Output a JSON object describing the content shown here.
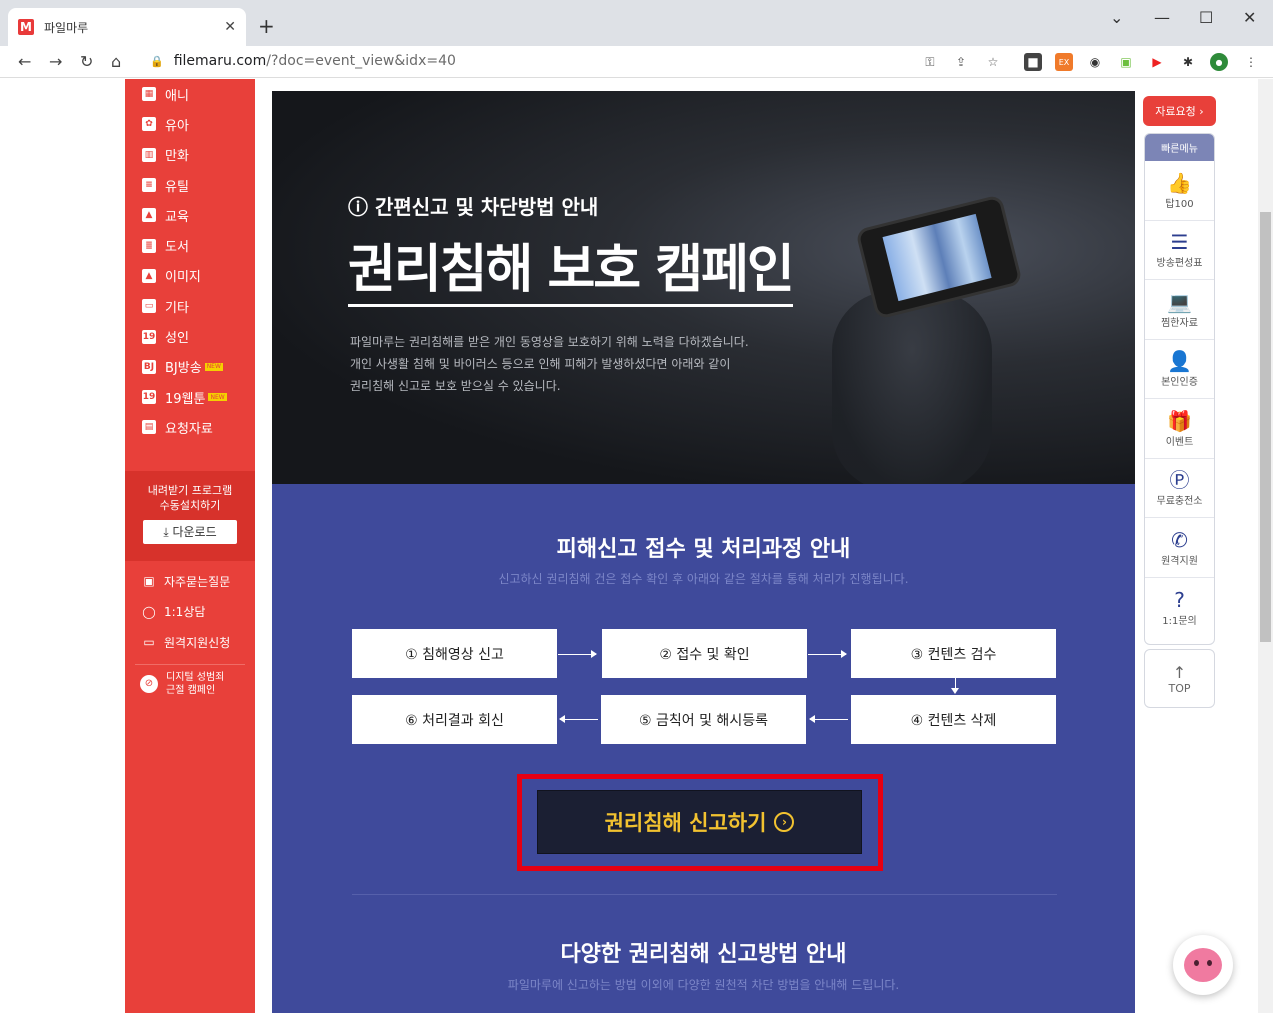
{
  "browser": {
    "tab_title": "파일마루",
    "tab_favicon": "M",
    "url_domain": "filemaru.com",
    "url_path": "/?doc=event_view&idx=40"
  },
  "sidebar": {
    "items": [
      {
        "icon": "anime-icon",
        "label": "애니"
      },
      {
        "icon": "baby-icon",
        "label": "유아"
      },
      {
        "icon": "comic-icon",
        "label": "만화"
      },
      {
        "icon": "utility-icon",
        "label": "유틸"
      },
      {
        "icon": "education-icon",
        "label": "교육"
      },
      {
        "icon": "book-icon",
        "label": "도서"
      },
      {
        "icon": "image-icon",
        "label": "이미지"
      },
      {
        "icon": "etc-icon",
        "label": "기타"
      },
      {
        "icon": "adult-icon",
        "label": "성인"
      },
      {
        "icon": "bj-broadcast-icon",
        "label": "BJ방송",
        "badge": "NEW"
      },
      {
        "icon": "webtoon-icon",
        "label": "19웹툰",
        "badge": "NEW"
      },
      {
        "icon": "request-icon",
        "label": "요청자료"
      }
    ],
    "download_box": {
      "line1": "내려받기 프로그램",
      "line2": "수동설치하기",
      "button": "다운로드"
    },
    "lower_items": [
      {
        "icon": "faq-icon",
        "label": "자주묻는질문"
      },
      {
        "icon": "chat-icon",
        "label": "1:1상담"
      },
      {
        "icon": "monitor-icon",
        "label": "원격지원신청"
      }
    ],
    "campaign": {
      "line1": "디지털 성범죄",
      "line2": "근절 캠페인"
    }
  },
  "hero": {
    "subtitle": "간편신고 및 차단방법 안내",
    "title": "권리침해 보호 캠페인",
    "desc_line1": "파일마루는 권리침해를 받은 개인 동영상을 보호하기 위해 노력을 다하겠습니다.",
    "desc_line2": "개인 사생활 침해 및 바이러스 등으로 인해 피해가 발생하셨다면 아래와 같이",
    "desc_line3": "권리침해 신고로 보호 받으실 수 있습니다."
  },
  "process": {
    "title": "피해신고 접수 및 처리과정 안내",
    "desc": "신고하신 권리침해 건은 접수 확인 후 아래와 같은 절차를 통해 처리가 진행됩니다.",
    "steps": [
      "① 침해영상 신고",
      "② 접수 및 확인",
      "③ 컨텐츠 검수",
      "④ 컨텐츠 삭제",
      "⑤ 금칙어 및 해시등록",
      "⑥ 처리결과 회신"
    ],
    "report_button": "권리침해 신고하기"
  },
  "methods": {
    "title": "다양한 권리침해 신고방법 안내",
    "desc": "파일마루에 신고하는 방법 이외에 다양한 원천적 차단 방법을 안내해 드립니다."
  },
  "quick_menu": {
    "request_label": "자료요청 ›",
    "head": "빠른메뉴",
    "items": [
      {
        "icon": "thumbs-up-icon",
        "label": "탑100"
      },
      {
        "icon": "list-icon",
        "label": "방송편성표"
      },
      {
        "icon": "laptop-icon",
        "label": "찜한자료"
      },
      {
        "icon": "user-check-icon",
        "label": "본인인증"
      },
      {
        "icon": "gift-icon",
        "label": "이벤트"
      },
      {
        "icon": "point-charge-icon",
        "label": "무료충전소"
      },
      {
        "icon": "remote-support-icon",
        "label": "원격지원"
      },
      {
        "icon": "inquiry-icon",
        "label": "1:1문의"
      }
    ],
    "top_label": "TOP"
  }
}
